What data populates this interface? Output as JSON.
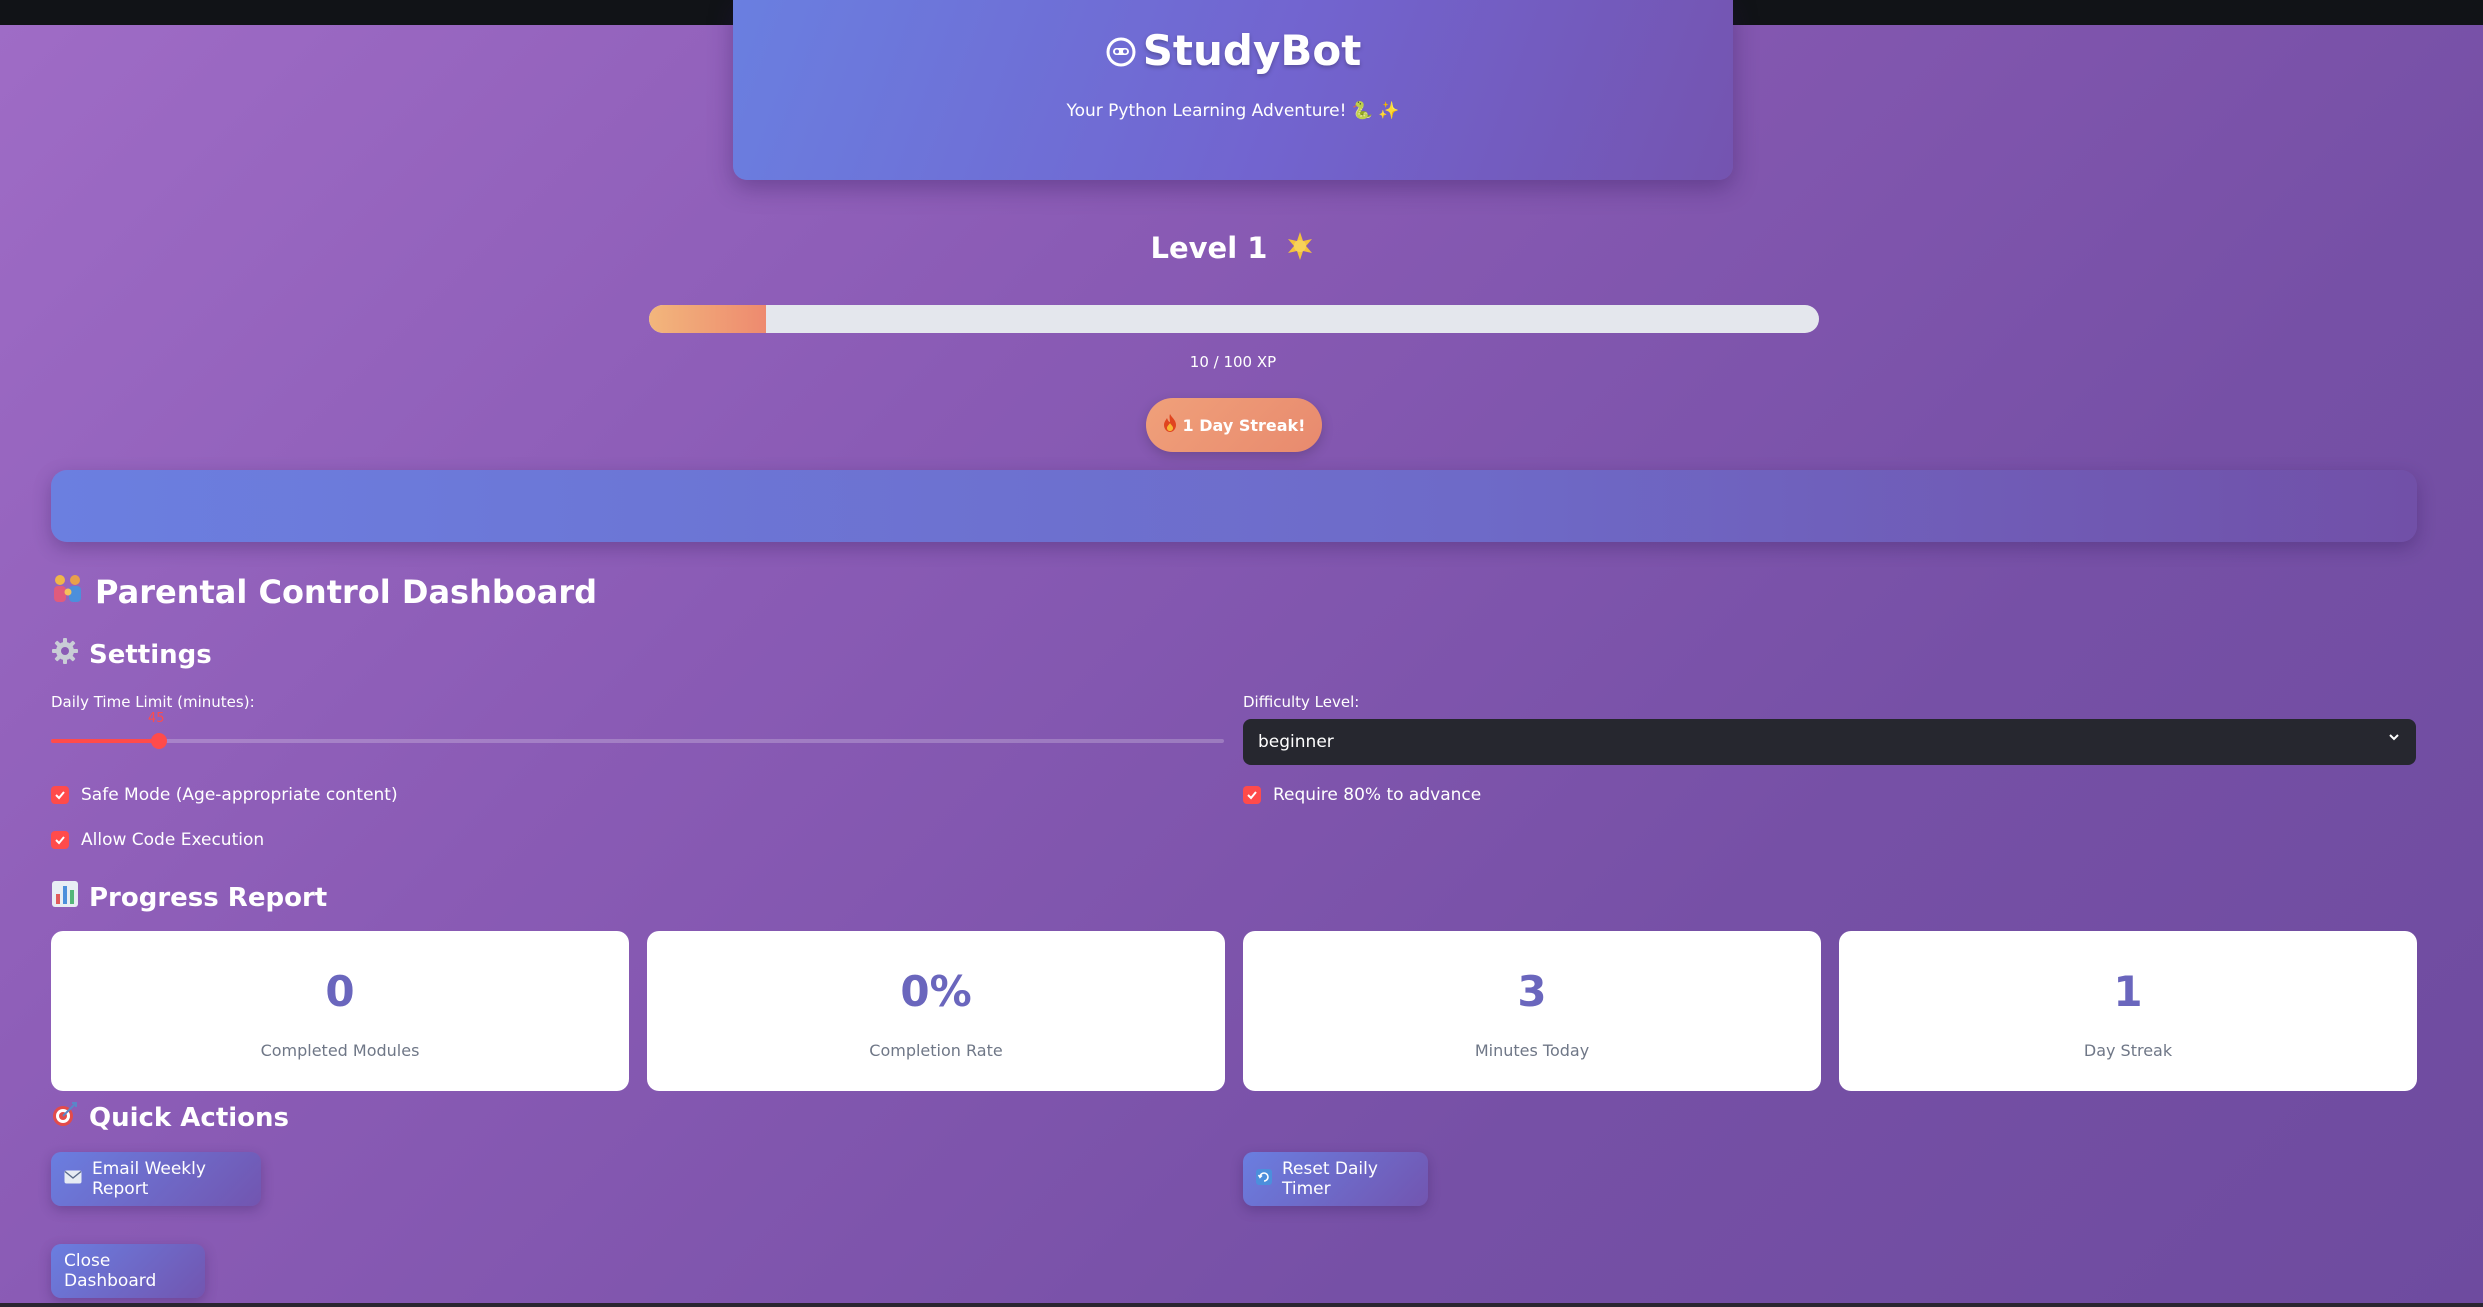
{
  "colors": {
    "accent": "#ff4b4b",
    "card_number": "#6a66bd",
    "background_start": "#9f6cc6",
    "background_end": "#6e4b9f"
  },
  "hero": {
    "title": "StudyBot",
    "subtitle": "Your Python Learning Adventure! 🐍 ✨",
    "title_icon": "robot-face-icon"
  },
  "level": {
    "label": "Level 1",
    "icon": "star-icon",
    "xp_text": "10 / 100 XP",
    "xp_current": 10,
    "xp_max": 100
  },
  "streak": {
    "label": "1 Day Streak!",
    "icon": "fire-icon"
  },
  "dashboard": {
    "title": "Parental Control Dashboard",
    "icon": "family-icon"
  },
  "settings": {
    "title": "Settings",
    "icon": "gear-icon",
    "time_limit_label": "Daily Time Limit (minutes):",
    "time_limit_value": "45",
    "time_limit_fraction": 0.09,
    "difficulty_label": "Difficulty Level:",
    "difficulty_value": "beginner",
    "checkboxes": [
      {
        "label": "Safe Mode (Age-appropriate content)",
        "checked": true
      },
      {
        "label": "Allow Code Execution",
        "checked": true
      },
      {
        "label": "Require 80% to advance",
        "checked": true
      }
    ]
  },
  "progress": {
    "title": "Progress Report",
    "icon": "bar-chart-icon",
    "cards": [
      {
        "value": "0",
        "label": "Completed Modules"
      },
      {
        "value": "0%",
        "label": "Completion Rate"
      },
      {
        "value": "3",
        "label": "Minutes Today"
      },
      {
        "value": "1",
        "label": "Day Streak"
      }
    ]
  },
  "actions": {
    "title": "Quick Actions",
    "icon": "target-icon",
    "email_label": "Email Weekly Report",
    "reset_label": "Reset Daily Timer",
    "close_label": "Close Dashboard"
  }
}
